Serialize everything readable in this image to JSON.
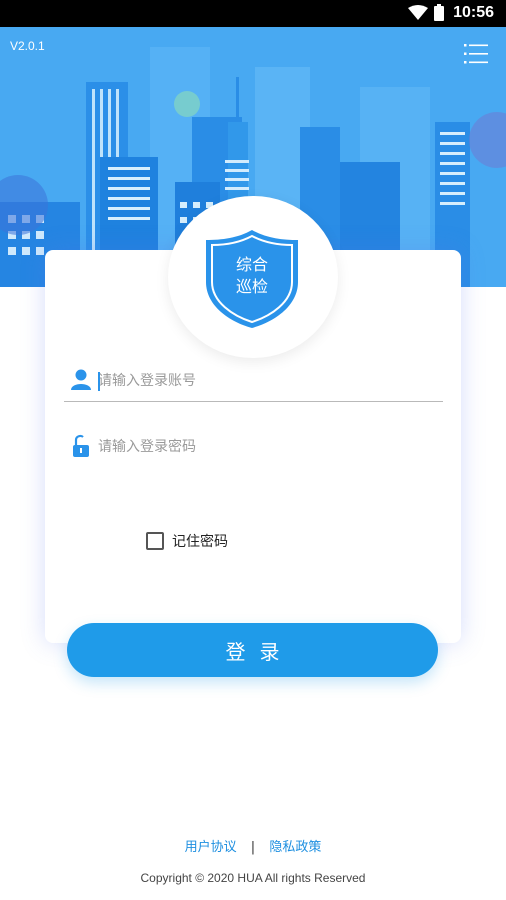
{
  "status_bar": {
    "time": "10:56",
    "icons": [
      "wifi-icon",
      "battery-icon"
    ]
  },
  "header": {
    "version": "V2.0.1",
    "menu_icon": "list-menu-icon"
  },
  "logo": {
    "text_line1": "综合",
    "text_line2": "巡检",
    "color": "#2a93ea"
  },
  "form": {
    "username_placeholder": "请输入登录账号",
    "password_placeholder": "请输入登录密码",
    "remember_label": "记住密码",
    "remember_checked": false,
    "login_label": "登录"
  },
  "footer": {
    "user_agreement": "用户协议",
    "separator": "|",
    "privacy_policy": "隐私政策",
    "copyright": "Copyright © 2020 HUA All rights Reserved"
  },
  "colors": {
    "primary": "#1f9be9",
    "header_bg": "#3aa0f0"
  }
}
